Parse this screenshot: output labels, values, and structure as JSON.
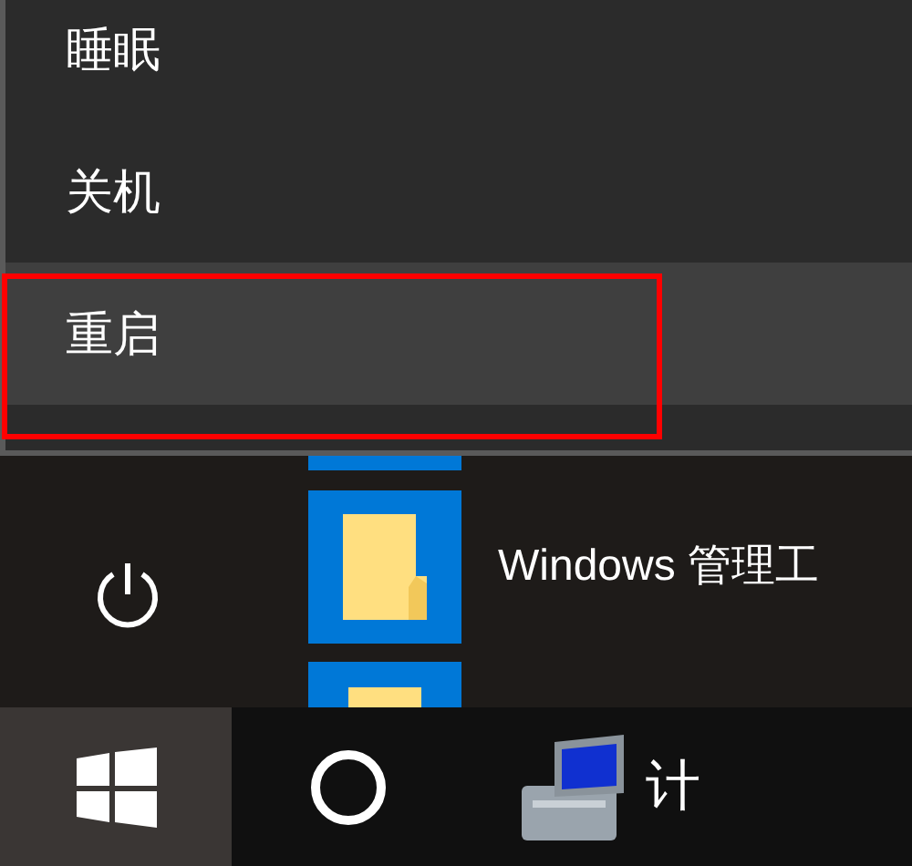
{
  "power_menu": {
    "items": [
      {
        "label": "睡眠",
        "selected": false
      },
      {
        "label": "关机",
        "selected": false
      },
      {
        "label": "重启",
        "selected": true
      }
    ]
  },
  "start_menu": {
    "app": {
      "label": "Windows 管理工"
    }
  },
  "taskbar": {
    "app": {
      "label": "计"
    }
  }
}
